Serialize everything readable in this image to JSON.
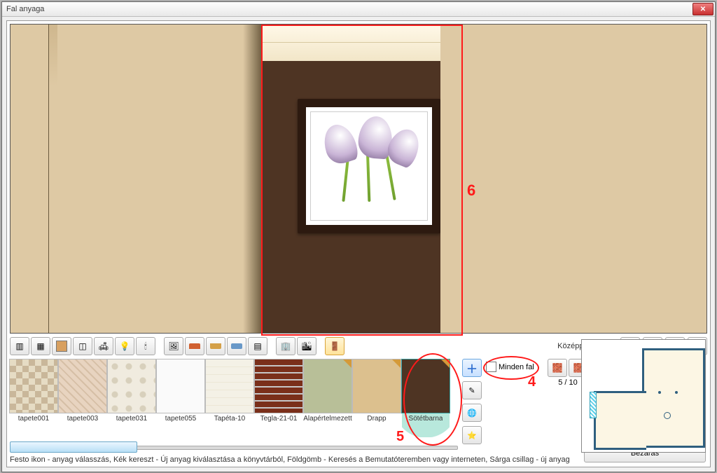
{
  "window": {
    "title": "Fal anyaga"
  },
  "annotations": {
    "sel_number": "6",
    "minden_number": "4",
    "thumb_number": "5"
  },
  "centerpoint": {
    "label": "Középpontba"
  },
  "minden_fal": {
    "label": "Minden fal"
  },
  "pager": {
    "text": "5 / 10"
  },
  "thumbs": [
    {
      "label": "tapete001"
    },
    {
      "label": "tapete003"
    },
    {
      "label": "tapete031"
    },
    {
      "label": "tapete055"
    },
    {
      "label": "Tapéta-10"
    },
    {
      "label": "Tegla-21-01"
    },
    {
      "label": "Alapértelmezett"
    },
    {
      "label": "Drapp"
    },
    {
      "label": "Sötétbarna"
    }
  ],
  "help": {
    "text": "Festo ikon - anyag válasszás, Kék kereszt - Új anyag kiválasztása a könyvtárból, Földgömb - Keresés a Bemutatóteremben vagy interneten, Sárga csillag - új anyag"
  },
  "close": {
    "label": "Bezárás"
  }
}
